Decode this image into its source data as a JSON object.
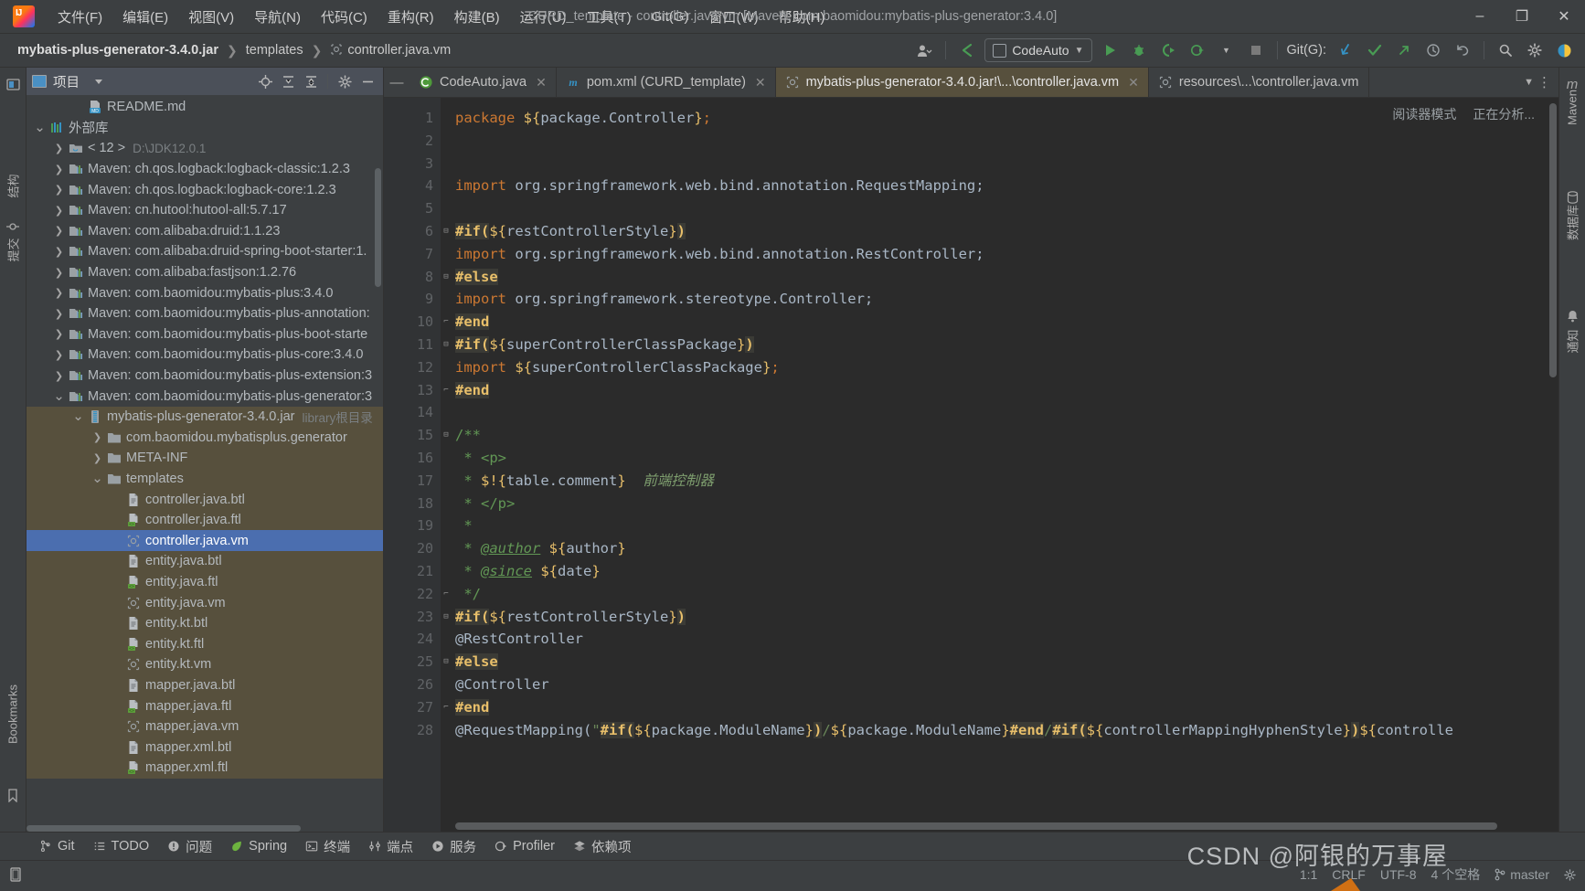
{
  "window": {
    "title": "CURD_template - controller.java.vm [Maven: com.baomidou:mybatis-plus-generator:3.4.0]",
    "minimize": "–",
    "maximize": "❐",
    "close": "✕",
    "logo": "intellij-idea-logo"
  },
  "menubar": [
    {
      "label": "文件(F)",
      "name": "menu-file"
    },
    {
      "label": "编辑(E)",
      "name": "menu-edit"
    },
    {
      "label": "视图(V)",
      "name": "menu-view"
    },
    {
      "label": "导航(N)",
      "name": "menu-navigate"
    },
    {
      "label": "代码(C)",
      "name": "menu-code"
    },
    {
      "label": "重构(R)",
      "name": "menu-refactor"
    },
    {
      "label": "构建(B)",
      "name": "menu-build"
    },
    {
      "label": "运行(U)",
      "name": "menu-run"
    },
    {
      "label": "工具(T)",
      "name": "menu-tools"
    },
    {
      "label": "Git(G)",
      "name": "menu-git"
    },
    {
      "label": "窗口(W)",
      "name": "menu-window"
    },
    {
      "label": "帮助(H)",
      "name": "menu-help"
    }
  ],
  "breadcrumb": {
    "items": [
      "mybatis-plus-generator-3.4.0.jar",
      "templates",
      "controller.java.vm"
    ],
    "sep": "❯"
  },
  "toolbar": {
    "run_config": "CodeAuto",
    "run_config_caret": "▼",
    "git_label": "Git(G):",
    "icons": [
      "user-icon",
      "back-arrow-icon",
      "run-icon",
      "debug-icon",
      "run-with-coverage-icon",
      "profile-icon",
      "stop-icon",
      "git-update-icon",
      "git-commit-icon",
      "git-push-icon",
      "history-icon",
      "rollback-icon",
      "search-everywhere-icon",
      "settings-icon",
      "account-icon"
    ]
  },
  "project_panel": {
    "title": "项目",
    "caret": "▼",
    "actions": [
      "locate-icon",
      "expand-all-icon",
      "collapse-all-icon",
      "settings-icon",
      "hide-icon"
    ],
    "tree": [
      {
        "label": "README.md",
        "indent": 2,
        "arrow": "",
        "icon": "md-file-icon",
        "style": "normal"
      },
      {
        "label": "外部库",
        "indent": 0,
        "arrow": "v",
        "icon": "library-icon",
        "style": "normal"
      },
      {
        "label": "< 12 >",
        "suffix": "D:\\JDK12.0.1",
        "indent": 1,
        "arrow": ">",
        "icon": "jdk-icon",
        "style": "normal"
      },
      {
        "label": "Maven: ch.qos.logback:logback-classic:1.2.3",
        "indent": 1,
        "arrow": ">",
        "icon": "maven-lib-icon",
        "style": "normal"
      },
      {
        "label": "Maven: ch.qos.logback:logback-core:1.2.3",
        "indent": 1,
        "arrow": ">",
        "icon": "maven-lib-icon",
        "style": "normal"
      },
      {
        "label": "Maven: cn.hutool:hutool-all:5.7.17",
        "indent": 1,
        "arrow": ">",
        "icon": "maven-lib-icon",
        "style": "normal"
      },
      {
        "label": "Maven: com.alibaba:druid:1.1.23",
        "indent": 1,
        "arrow": ">",
        "icon": "maven-lib-icon",
        "style": "normal"
      },
      {
        "label": "Maven: com.alibaba:druid-spring-boot-starter:1.",
        "indent": 1,
        "arrow": ">",
        "icon": "maven-lib-icon",
        "style": "normal"
      },
      {
        "label": "Maven: com.alibaba:fastjson:1.2.76",
        "indent": 1,
        "arrow": ">",
        "icon": "maven-lib-icon",
        "style": "normal"
      },
      {
        "label": "Maven: com.baomidou:mybatis-plus:3.4.0",
        "indent": 1,
        "arrow": ">",
        "icon": "maven-lib-icon",
        "style": "normal"
      },
      {
        "label": "Maven: com.baomidou:mybatis-plus-annotation:",
        "indent": 1,
        "arrow": ">",
        "icon": "maven-lib-icon",
        "style": "normal"
      },
      {
        "label": "Maven: com.baomidou:mybatis-plus-boot-starte",
        "indent": 1,
        "arrow": ">",
        "icon": "maven-lib-icon",
        "style": "normal"
      },
      {
        "label": "Maven: com.baomidou:mybatis-plus-core:3.4.0",
        "indent": 1,
        "arrow": ">",
        "icon": "maven-lib-icon",
        "style": "normal"
      },
      {
        "label": "Maven: com.baomidou:mybatis-plus-extension:3",
        "indent": 1,
        "arrow": ">",
        "icon": "maven-lib-icon",
        "style": "normal"
      },
      {
        "label": "Maven: com.baomidou:mybatis-plus-generator:3",
        "indent": 1,
        "arrow": "v",
        "icon": "maven-lib-icon",
        "style": "normal"
      },
      {
        "label": "mybatis-plus-generator-3.4.0.jar",
        "suffix": "library根目录",
        "indent": 2,
        "arrow": "v",
        "icon": "jar-icon",
        "style": "jar"
      },
      {
        "label": "com.baomidou.mybatisplus.generator",
        "indent": 3,
        "arrow": ">",
        "icon": "folder-icon",
        "style": "jar"
      },
      {
        "label": "META-INF",
        "indent": 3,
        "arrow": ">",
        "icon": "folder-icon",
        "style": "jar"
      },
      {
        "label": "templates",
        "indent": 3,
        "arrow": "v",
        "icon": "folder-icon",
        "style": "jar"
      },
      {
        "label": "controller.java.btl",
        "indent": 4,
        "arrow": "",
        "icon": "text-file-icon",
        "style": "jar"
      },
      {
        "label": "controller.java.ftl",
        "indent": 4,
        "arrow": "",
        "icon": "ftl-file-icon",
        "style": "jar"
      },
      {
        "label": "controller.java.vm",
        "indent": 4,
        "arrow": "",
        "icon": "vm-file-icon",
        "style": "selected"
      },
      {
        "label": "entity.java.btl",
        "indent": 4,
        "arrow": "",
        "icon": "text-file-icon",
        "style": "jar"
      },
      {
        "label": "entity.java.ftl",
        "indent": 4,
        "arrow": "",
        "icon": "ftl-file-icon",
        "style": "jar"
      },
      {
        "label": "entity.java.vm",
        "indent": 4,
        "arrow": "",
        "icon": "vm-file-icon",
        "style": "jar"
      },
      {
        "label": "entity.kt.btl",
        "indent": 4,
        "arrow": "",
        "icon": "text-file-icon",
        "style": "jar"
      },
      {
        "label": "entity.kt.ftl",
        "indent": 4,
        "arrow": "",
        "icon": "ftl-file-icon",
        "style": "jar"
      },
      {
        "label": "entity.kt.vm",
        "indent": 4,
        "arrow": "",
        "icon": "vm-file-icon",
        "style": "jar"
      },
      {
        "label": "mapper.java.btl",
        "indent": 4,
        "arrow": "",
        "icon": "text-file-icon",
        "style": "jar"
      },
      {
        "label": "mapper.java.ftl",
        "indent": 4,
        "arrow": "",
        "icon": "ftl-file-icon",
        "style": "jar"
      },
      {
        "label": "mapper.java.vm",
        "indent": 4,
        "arrow": "",
        "icon": "vm-file-icon",
        "style": "jar"
      },
      {
        "label": "mapper.xml.btl",
        "indent": 4,
        "arrow": "",
        "icon": "text-file-icon",
        "style": "jar"
      },
      {
        "label": "mapper.xml.ftl",
        "indent": 4,
        "arrow": "",
        "icon": "ftl-file-icon",
        "style": "jar"
      }
    ]
  },
  "left_rail": [
    {
      "label": "结构",
      "name": "rail-structure"
    },
    {
      "label": "提交",
      "name": "rail-commit"
    },
    {
      "label": "Bookmarks",
      "name": "rail-bookmarks"
    }
  ],
  "right_rail": [
    {
      "label": "Maven",
      "name": "rail-maven"
    },
    {
      "label": "数据库",
      "name": "rail-database"
    },
    {
      "label": "通知",
      "name": "rail-notifications"
    }
  ],
  "editor": {
    "tabs": [
      {
        "label": "CodeAuto.java",
        "icon": "java-class-icon",
        "active": false,
        "closable": true
      },
      {
        "label": "pom.xml (CURD_template)",
        "icon": "maven-xml-icon",
        "active": false,
        "closable": true
      },
      {
        "label": "mybatis-plus-generator-3.4.0.jar!\\...\\controller.java.vm",
        "icon": "vm-file-icon",
        "active": true,
        "closable": true
      },
      {
        "label": "resources\\...\\controller.java.vm",
        "icon": "vm-file-icon",
        "active": false,
        "closable": false
      }
    ],
    "tabs_overflow": "▼",
    "tabs_more": "⋮",
    "reader_mode": "阅读器模式",
    "analyzing": "正在分析...",
    "first_line": 1,
    "last_line": 28,
    "lines": [
      {
        "n": 1,
        "fold": "",
        "tokens": [
          {
            "t": "package ",
            "c": "kw"
          },
          {
            "t": "${",
            "c": "var"
          },
          {
            "t": "package.Controller",
            "c": "txt"
          },
          {
            "t": "}",
            "c": "var"
          },
          {
            "t": ";",
            "c": "brace"
          }
        ]
      },
      {
        "n": 2,
        "fold": "",
        "tokens": []
      },
      {
        "n": 3,
        "fold": "",
        "tokens": []
      },
      {
        "n": 4,
        "fold": "",
        "tokens": [
          {
            "t": "import ",
            "c": "kw"
          },
          {
            "t": "org.springframework.web.bind.annotation.RequestMapping;",
            "c": "txt"
          }
        ]
      },
      {
        "n": 5,
        "fold": "",
        "tokens": []
      },
      {
        "n": 6,
        "fold": "-",
        "tokens": [
          {
            "t": "#if(",
            "c": "dir"
          },
          {
            "t": "${",
            "c": "var"
          },
          {
            "t": "restControllerStyle",
            "c": "txt"
          },
          {
            "t": "}",
            "c": "var"
          },
          {
            "t": ")",
            "c": "dir"
          }
        ]
      },
      {
        "n": 7,
        "fold": "",
        "tokens": [
          {
            "t": "import ",
            "c": "kw"
          },
          {
            "t": "org.springframework.web.bind.annotation.RestController;",
            "c": "txt"
          }
        ]
      },
      {
        "n": 8,
        "fold": "-",
        "tokens": [
          {
            "t": "#else",
            "c": "dir"
          }
        ]
      },
      {
        "n": 9,
        "fold": "",
        "tokens": [
          {
            "t": "import ",
            "c": "kw"
          },
          {
            "t": "org.springframework.stereotype.Controller;",
            "c": "txt"
          }
        ]
      },
      {
        "n": 10,
        "fold": "+",
        "tokens": [
          {
            "t": "#end",
            "c": "dir"
          }
        ]
      },
      {
        "n": 11,
        "fold": "-",
        "tokens": [
          {
            "t": "#if(",
            "c": "dir"
          },
          {
            "t": "${",
            "c": "var"
          },
          {
            "t": "superControllerClassPackage",
            "c": "txt"
          },
          {
            "t": "}",
            "c": "var"
          },
          {
            "t": ")",
            "c": "dir"
          }
        ]
      },
      {
        "n": 12,
        "fold": "",
        "tokens": [
          {
            "t": "import ",
            "c": "kw"
          },
          {
            "t": "${",
            "c": "var"
          },
          {
            "t": "superControllerClassPackage",
            "c": "txt"
          },
          {
            "t": "}",
            "c": "var"
          },
          {
            "t": ";",
            "c": "brace"
          }
        ]
      },
      {
        "n": 13,
        "fold": "+",
        "tokens": [
          {
            "t": "#end",
            "c": "dir"
          }
        ]
      },
      {
        "n": 14,
        "fold": "",
        "tokens": []
      },
      {
        "n": 15,
        "fold": "-",
        "tokens": [
          {
            "t": "/**",
            "c": "cmt"
          }
        ]
      },
      {
        "n": 16,
        "fold": "",
        "tokens": [
          {
            "t": " * <p>",
            "c": "cmt"
          }
        ]
      },
      {
        "n": 17,
        "fold": "",
        "tokens": [
          {
            "t": " * ",
            "c": "cmt"
          },
          {
            "t": "$!{",
            "c": "var"
          },
          {
            "t": "table.comment",
            "c": "txt"
          },
          {
            "t": "}",
            "c": "var"
          },
          {
            "t": "  前端控制器",
            "c": "cjk"
          }
        ]
      },
      {
        "n": 18,
        "fold": "",
        "tokens": [
          {
            "t": " * </p>",
            "c": "cmt"
          }
        ]
      },
      {
        "n": 19,
        "fold": "",
        "tokens": [
          {
            "t": " *",
            "c": "cmt"
          }
        ]
      },
      {
        "n": 20,
        "fold": "",
        "tokens": [
          {
            "t": " * ",
            "c": "cmt"
          },
          {
            "t": "@author",
            "c": "doctag"
          },
          {
            "t": " ",
            "c": "cmt"
          },
          {
            "t": "${",
            "c": "var"
          },
          {
            "t": "author",
            "c": "txt"
          },
          {
            "t": "}",
            "c": "var"
          }
        ]
      },
      {
        "n": 21,
        "fold": "",
        "tokens": [
          {
            "t": " * ",
            "c": "cmt"
          },
          {
            "t": "@since",
            "c": "doctag"
          },
          {
            "t": " ",
            "c": "cmt"
          },
          {
            "t": "${",
            "c": "var"
          },
          {
            "t": "date",
            "c": "txt"
          },
          {
            "t": "}",
            "c": "var"
          }
        ]
      },
      {
        "n": 22,
        "fold": "+",
        "tokens": [
          {
            "t": " */",
            "c": "cmt"
          }
        ]
      },
      {
        "n": 23,
        "fold": "-",
        "tokens": [
          {
            "t": "#if(",
            "c": "dir"
          },
          {
            "t": "${",
            "c": "var"
          },
          {
            "t": "restControllerStyle",
            "c": "txt"
          },
          {
            "t": "}",
            "c": "var"
          },
          {
            "t": ")",
            "c": "dir"
          }
        ]
      },
      {
        "n": 24,
        "fold": "",
        "tokens": [
          {
            "t": "@RestController",
            "c": "txt"
          }
        ]
      },
      {
        "n": 25,
        "fold": "-",
        "tokens": [
          {
            "t": "#else",
            "c": "dir"
          }
        ]
      },
      {
        "n": 26,
        "fold": "",
        "tokens": [
          {
            "t": "@Controller",
            "c": "txt"
          }
        ]
      },
      {
        "n": 27,
        "fold": "+",
        "tokens": [
          {
            "t": "#end",
            "c": "dir"
          }
        ]
      },
      {
        "n": 28,
        "fold": "",
        "tokens": [
          {
            "t": "@RequestMapping(",
            "c": "txt"
          },
          {
            "t": "\"",
            "c": "strlit"
          },
          {
            "t": "#if(",
            "c": "dir"
          },
          {
            "t": "${",
            "c": "var"
          },
          {
            "t": "package.ModuleName",
            "c": "txt"
          },
          {
            "t": "}",
            "c": "var"
          },
          {
            "t": ")",
            "c": "dir"
          },
          {
            "t": "/",
            "c": "strlit"
          },
          {
            "t": "${",
            "c": "var"
          },
          {
            "t": "package.ModuleName",
            "c": "txt"
          },
          {
            "t": "}",
            "c": "var"
          },
          {
            "t": "#end",
            "c": "dir"
          },
          {
            "t": "/",
            "c": "strlit"
          },
          {
            "t": "#if(",
            "c": "dir"
          },
          {
            "t": "${",
            "c": "var"
          },
          {
            "t": "controllerMappingHyphenStyle",
            "c": "txt"
          },
          {
            "t": "}",
            "c": "var"
          },
          {
            "t": ")",
            "c": "dir"
          },
          {
            "t": "${",
            "c": "var"
          },
          {
            "t": "controlle",
            "c": "txt"
          }
        ]
      }
    ]
  },
  "tool_windows": [
    {
      "label": "Git",
      "icon": "git-branch-icon",
      "name": "toolwindow-git"
    },
    {
      "label": "TODO",
      "icon": "todo-list-icon",
      "name": "toolwindow-todo"
    },
    {
      "label": "问题",
      "icon": "problems-icon",
      "name": "toolwindow-problems"
    },
    {
      "label": "Spring",
      "icon": "spring-leaf-icon",
      "name": "toolwindow-spring"
    },
    {
      "label": "终端",
      "icon": "terminal-icon",
      "name": "toolwindow-terminal"
    },
    {
      "label": "端点",
      "icon": "endpoints-icon",
      "name": "toolwindow-endpoints"
    },
    {
      "label": "服务",
      "icon": "services-icon",
      "name": "toolwindow-services"
    },
    {
      "label": "Profiler",
      "icon": "profiler-icon",
      "name": "toolwindow-profiler"
    },
    {
      "label": "依赖项",
      "icon": "dependencies-icon",
      "name": "toolwindow-dependencies"
    }
  ],
  "statusbar": {
    "left_icon": "memory-indicator-icon",
    "caret_position": "1:1",
    "line_separator": "CRLF",
    "encoding": "UTF-8",
    "indent": "4 个空格",
    "branch": "master",
    "branch_icon": "git-branch-icon",
    "settings_icon": "gear-icon",
    "watermark": "CSDN @阿银的万事屋"
  }
}
